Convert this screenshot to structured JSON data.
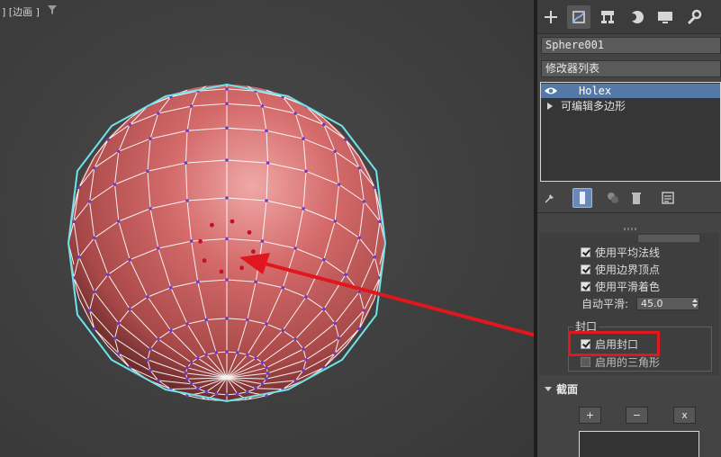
{
  "viewport": {
    "label": "] [边画 ]",
    "filter_icon": "filter-icon"
  },
  "tabs": [
    {
      "name": "create",
      "icon": "plus-icon"
    },
    {
      "name": "modify",
      "icon": "modify-icon"
    },
    {
      "name": "hierarchy",
      "icon": "hierarchy-icon"
    },
    {
      "name": "motion",
      "icon": "motion-icon"
    },
    {
      "name": "display",
      "icon": "display-icon"
    },
    {
      "name": "utilities",
      "icon": "wrench-icon"
    }
  ],
  "object_name": "Sphere001",
  "modifier_list": "修改器列表",
  "stack": {
    "modifier": "Holex",
    "base": "可编辑多边形"
  },
  "stack_tools": [
    "pin-icon",
    "show-end-result-icon",
    "make-unique-icon",
    "remove-modifier-icon",
    "configure-icon"
  ],
  "options": {
    "use_avg_normals": "使用平均法线",
    "use_edge_verts": "使用边界顶点",
    "use_smooth_shading": "使用平滑着色",
    "auto_smooth_label": "自动平滑:",
    "auto_smooth_value": "45.0"
  },
  "cap": {
    "group_title": "封口",
    "enable_cap": "启用封口",
    "enable_tri": "启用的三角形"
  },
  "section": {
    "title": "截面",
    "add": "+",
    "remove": "−",
    "clear": "x"
  },
  "colors": {
    "sphere": "#c85a5a",
    "wire": "#ffffff",
    "selection_outline": "#6fe3e8",
    "vertex": "#6a3cc9",
    "selected_vertex": "#c0102a",
    "annotation": "#e0171e",
    "stack_highlight": "#5478a8"
  }
}
